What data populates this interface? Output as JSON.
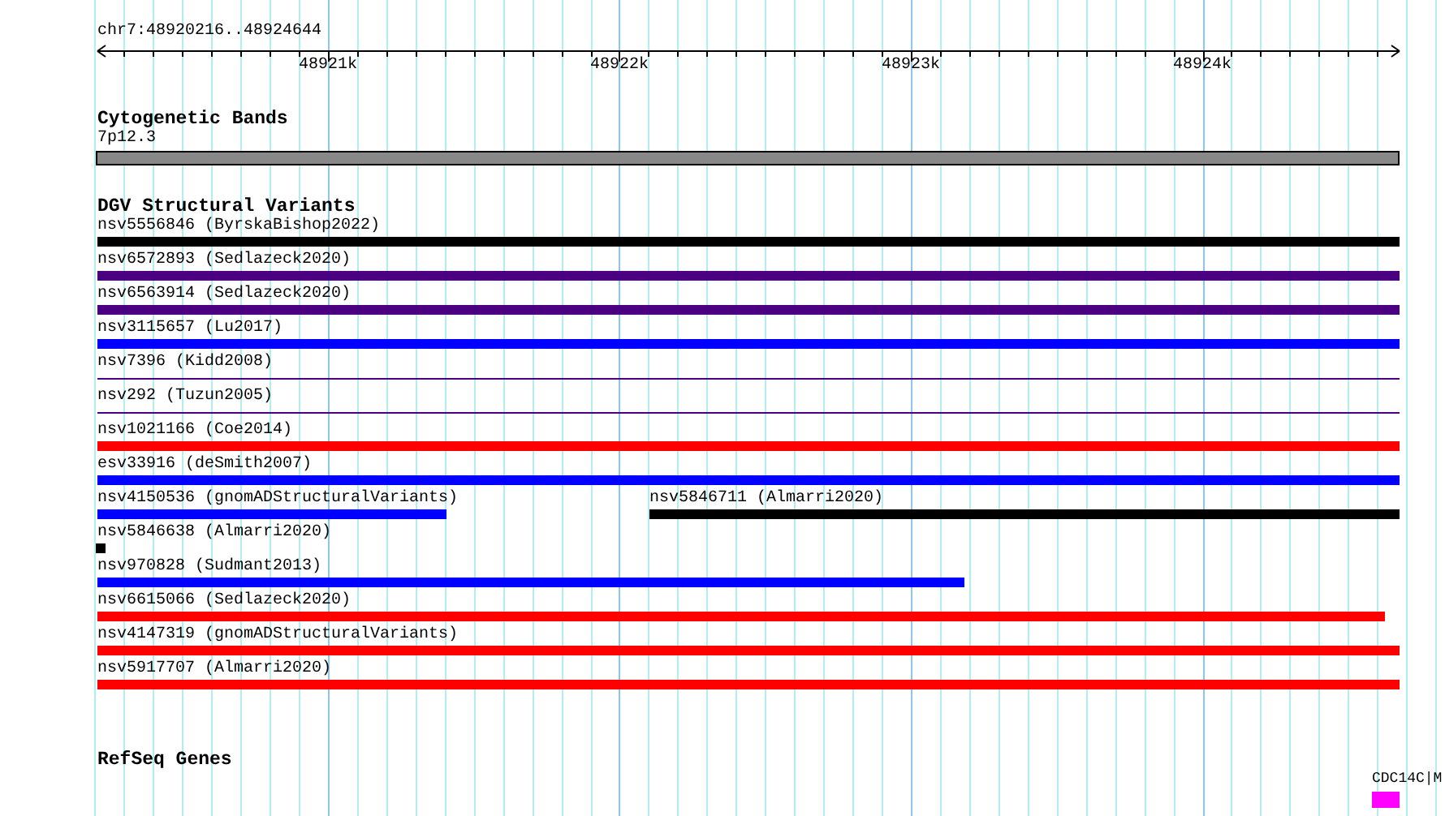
{
  "ruler": {
    "position": "chr7:48920216..48924644",
    "ticks": [
      "48921k",
      "48922k",
      "48923k",
      "48924k"
    ]
  },
  "cytogenetic_bands": {
    "title": "Cytogenetic Bands",
    "bands": [
      {
        "label": "7p12.3",
        "color": "#888888"
      }
    ]
  },
  "dgv_structural_variants": {
    "title": "DGV Structural Variants",
    "rows": [
      [
        {
          "label": "nsv5556846 (ByrskaBishop2022)",
          "color": "#000000",
          "kind": "bar"
        }
      ],
      [
        {
          "label": "nsv6572893 (Sedlazeck2020)",
          "color": "#4b0082",
          "kind": "bar"
        }
      ],
      [
        {
          "label": "nsv6563914 (Sedlazeck2020)",
          "color": "#4b0082",
          "kind": "bar"
        }
      ],
      [
        {
          "label": "nsv3115657 (Lu2017)",
          "color": "#0000ff",
          "kind": "bar"
        }
      ],
      [
        {
          "label": "nsv7396 (Kidd2008)",
          "color": "#4b0082",
          "kind": "line"
        }
      ],
      [
        {
          "label": "nsv292 (Tuzun2005)",
          "color": "#4b0082",
          "kind": "line"
        }
      ],
      [
        {
          "label": "nsv1021166 (Coe2014)",
          "color": "#ff0000",
          "kind": "bar"
        }
      ],
      [
        {
          "label": "esv33916 (deSmith2007)",
          "color": "#0000ff",
          "kind": "bar"
        }
      ],
      [
        {
          "label": "nsv4150536 (gnomADStructuralVariants)",
          "color": "#0000ff",
          "kind": "bar"
        },
        {
          "label": "nsv5846711 (Almarri2020)",
          "color": "#000000",
          "kind": "bar"
        }
      ],
      [
        {
          "label": "nsv5846638 (Almarri2020)",
          "color": "#000000",
          "kind": "bar"
        }
      ],
      [
        {
          "label": "nsv970828 (Sudmant2013)",
          "color": "#0000ff",
          "kind": "bar"
        }
      ],
      [
        {
          "label": "nsv6615066 (Sedlazeck2020)",
          "color": "#ff0000",
          "kind": "bar"
        }
      ],
      [
        {
          "label": "nsv4147319 (gnomADStructuralVariants)",
          "color": "#ff0000",
          "kind": "bar"
        }
      ],
      [
        {
          "label": "nsv5917707 (Almarri2020)",
          "color": "#ff0000",
          "kind": "bar"
        }
      ]
    ]
  },
  "refseq_genes": {
    "title": "RefSeq Genes",
    "genes": [
      {
        "label": "CDC14C|M",
        "color": "#ff00ff"
      }
    ]
  }
}
